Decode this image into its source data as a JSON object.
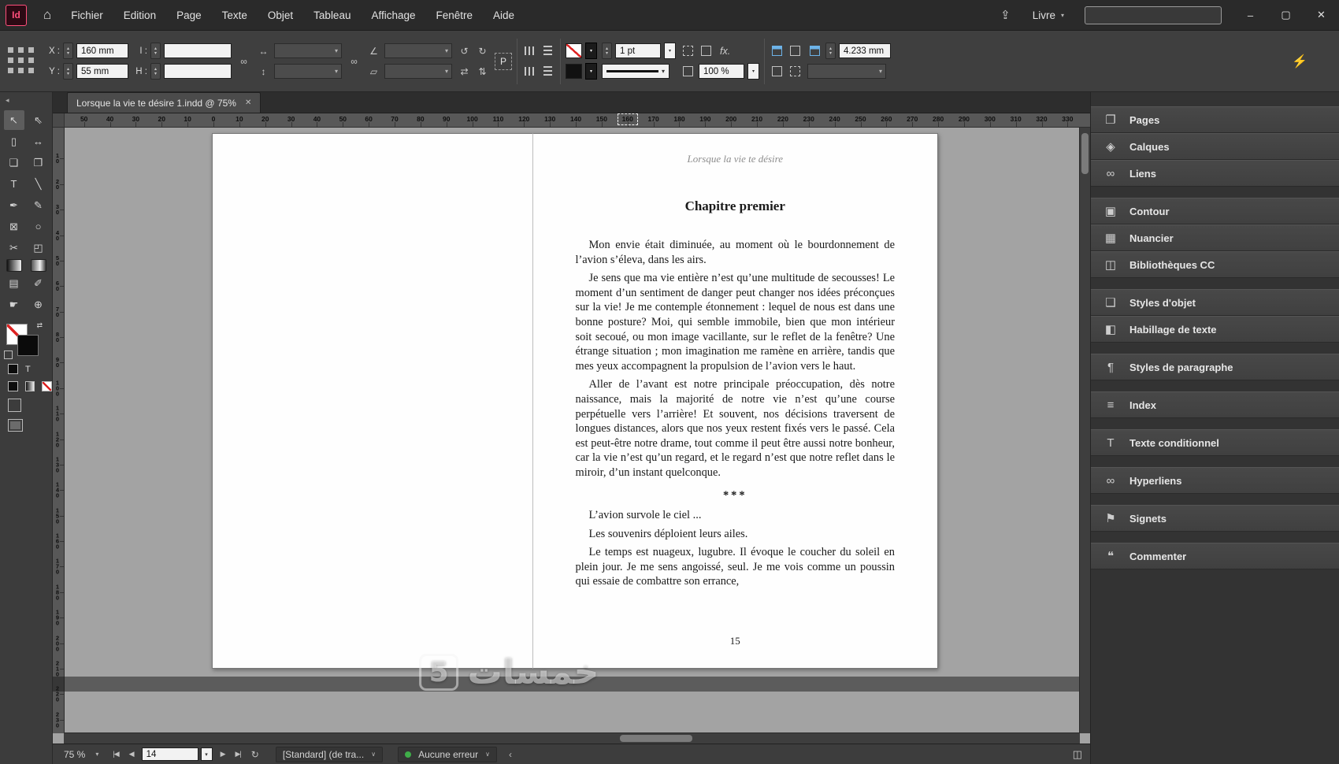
{
  "glyphs": {
    "up": "▴",
    "down": "▾",
    "chevron": "▾",
    "chevron_small": "∨",
    "home": "⌂",
    "share": "⇪",
    "collapse_left": "◂",
    "rotate_ccw": "↺",
    "rotate_cw": "↻",
    "flip_h": "⇄",
    "flip_v": "⇅",
    "link": "∞",
    "lightning": "⚡",
    "swap": "⇄",
    "minimize": "–",
    "maximize": "▢",
    "close": "✕",
    "tab_close": "✕",
    "first": "|◀",
    "prev": "◀",
    "next": "▶",
    "last": "▶|",
    "refresh": "↻",
    "spread_view": "◫",
    "lt": "‹",
    "angle": "∠",
    "shear": "▱",
    "scale_x": "↔",
    "scale_y": "↕",
    "t_small": "T"
  },
  "menubar": {
    "logo": "Id",
    "menus": [
      "Fichier",
      "Edition",
      "Page",
      "Texte",
      "Objet",
      "Tableau",
      "Affichage",
      "Fenêtre",
      "Aide"
    ],
    "workspace_dropdown": "Livre"
  },
  "control_bar": {
    "x_label": "X :",
    "x_value": "160 mm",
    "y_label": "Y :",
    "y_value": "55 mm",
    "w_label": "I :",
    "w_value": "",
    "h_label": "H :",
    "h_value": "",
    "flip_preview": "P",
    "stroke_weight": "1 pt",
    "effects_label": "fx.",
    "opacity": "100 %",
    "fitting_value": "4.233 mm"
  },
  "tab": {
    "title": "Lorsque la vie te désire 1.indd @ 75%"
  },
  "rulers": {
    "h_mm": [
      -50,
      -40,
      -30,
      -20,
      -10,
      0,
      10,
      20,
      30,
      40,
      50,
      60,
      70,
      80,
      90,
      100,
      110,
      120,
      130,
      140,
      150,
      160,
      170,
      180,
      190,
      200,
      210,
      220,
      230,
      240,
      250,
      260,
      270,
      280,
      290,
      300,
      310,
      320,
      330
    ],
    "v_mm": [
      10,
      20,
      30,
      40,
      50,
      60,
      70,
      80,
      90,
      100,
      110,
      120,
      130,
      140,
      150,
      160,
      170,
      180,
      190,
      200,
      210,
      220,
      230
    ],
    "cursor_mm": 160
  },
  "toolbar": [
    {
      "name": "selection-tool",
      "glyph": "↖",
      "active": true
    },
    {
      "name": "direct-selection-tool",
      "glyph": "⇖"
    },
    {
      "name": "page-tool",
      "glyph": "▯"
    },
    {
      "name": "gap-tool",
      "glyph": "↔"
    },
    {
      "name": "content-collector-tool",
      "glyph": "❏"
    },
    {
      "name": "content-placer-tool",
      "glyph": "❐"
    },
    {
      "name": "type-tool",
      "glyph": "T"
    },
    {
      "name": "line-tool",
      "glyph": "╲"
    },
    {
      "name": "pen-tool",
      "glyph": "✒"
    },
    {
      "name": "pencil-tool",
      "glyph": "✎"
    },
    {
      "name": "rectangle-frame-tool",
      "glyph": "⊠"
    },
    {
      "name": "ellipse-tool",
      "glyph": "○"
    },
    {
      "name": "scissors-tool",
      "glyph": "✂"
    },
    {
      "name": "free-transform-tool",
      "glyph": "◰"
    },
    {
      "name": "gradient-swatch-tool",
      "glyph": "",
      "css": "grad1"
    },
    {
      "name": "gradient-feather-tool",
      "glyph": "",
      "css": "grad2"
    },
    {
      "name": "note-tool",
      "glyph": "▤"
    },
    {
      "name": "eyedropper-tool",
      "glyph": "✐"
    },
    {
      "name": "hand-tool",
      "glyph": "☛"
    },
    {
      "name": "zoom-tool",
      "glyph": "⊕"
    }
  ],
  "panel_groups": [
    [
      {
        "label": "Pages",
        "glyph": "❐"
      },
      {
        "label": "Calques",
        "glyph": "◈"
      },
      {
        "label": "Liens",
        "glyph": "∞"
      }
    ],
    [
      {
        "label": "Contour",
        "glyph": "▣"
      },
      {
        "label": "Nuancier",
        "glyph": "▦"
      },
      {
        "label": "Bibliothèques CC",
        "glyph": "◫"
      }
    ],
    [
      {
        "label": "Styles d'objet",
        "glyph": "❑"
      },
      {
        "label": "Habillage de texte",
        "glyph": "◧"
      }
    ],
    [
      {
        "label": "Styles de paragraphe",
        "glyph": "¶"
      }
    ],
    [
      {
        "label": "Index",
        "glyph": "≡"
      }
    ],
    [
      {
        "label": "Texte conditionnel",
        "glyph": "T"
      }
    ],
    [
      {
        "label": "Hyperliens",
        "glyph": "∞"
      }
    ],
    [
      {
        "label": "Signets",
        "glyph": "⚑"
      }
    ],
    [
      {
        "label": "Commenter",
        "glyph": "❝"
      }
    ]
  ],
  "document": {
    "running_header": "Lorsque la vie te désire",
    "chapter_title": "Chapitre premier",
    "body": [
      {
        "type": "para",
        "text": "Mon envie était diminuée, au moment où le bourdonnement de l’avion s’éleva, dans les airs."
      },
      {
        "type": "para",
        "text": "Je sens que ma vie entière n’est qu’une multitude de secousses! Le moment d’un sentiment de danger peut changer nos idées préconçues sur la vie! Je me contemple étonnement : lequel de nous est dans une bonne posture? Moi, qui semble immobile, bien que mon intérieur soit secoué, ou mon image vacillante, sur le reflet de la fenêtre? Une étrange situation ; mon imagination me ramène en arrière, tandis que mes yeux accompagnent la propulsion de l’avion vers le haut."
      },
      {
        "type": "para",
        "text": "Aller de l’avant est notre principale préoccupation, dès notre naissance, mais la majorité de notre vie n’est qu’une course perpétuelle vers l’arrière! Et souvent, nos décisions traversent de longues distances, alors que nos yeux restent fixés vers le passé. Cela est peut-être notre drame, tout comme il peut être aussi notre bonheur, car la vie n’est qu’un regard, et le regard n’est que notre reflet dans le miroir, d’un instant quelconque."
      },
      {
        "type": "stars",
        "text": "***"
      },
      {
        "type": "line",
        "text": "L’avion survole le ciel ..."
      },
      {
        "type": "line",
        "text": "Les souvenirs déploient leurs ailes."
      },
      {
        "type": "para",
        "text": "Le temps est nuageux, lugubre. Il évoque le coucher du soleil en plein jour. Je me sens angoissé, seul. Je me vois comme un poussin qui essaie de combattre son errance,"
      }
    ],
    "page_number": "15"
  },
  "watermark": {
    "text": "خمسات",
    "logo": "5"
  },
  "statusbar": {
    "zoom": "75 %",
    "page_value": "14",
    "preset": "[Standard] (de tra...",
    "error_status": "Aucune erreur"
  }
}
